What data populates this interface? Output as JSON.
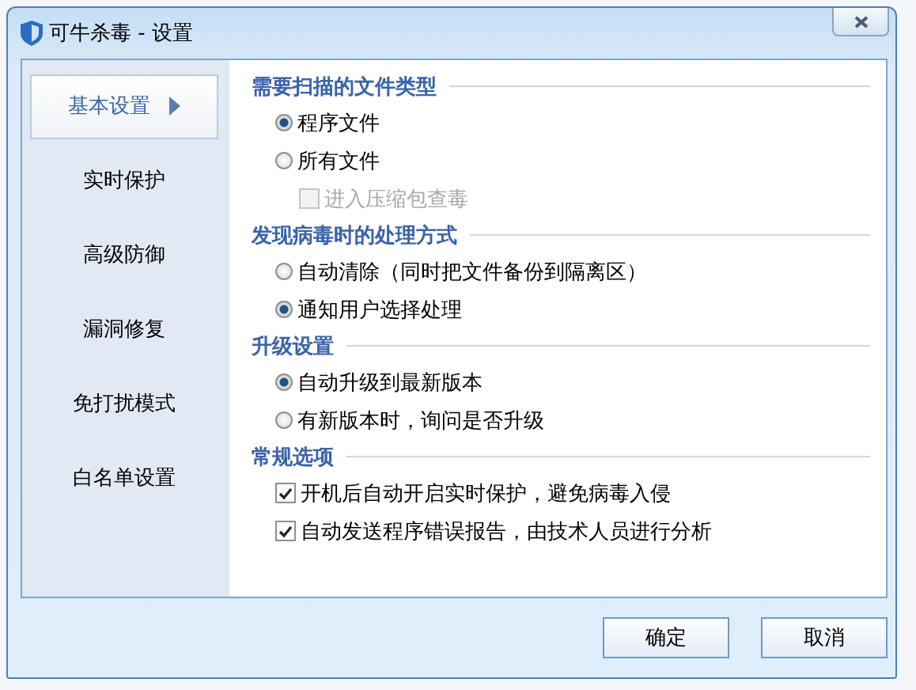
{
  "window": {
    "title": "可牛杀毒 - 设置"
  },
  "sidebar": {
    "items": [
      {
        "label": "基本设置",
        "selected": true
      },
      {
        "label": "实时保护",
        "selected": false
      },
      {
        "label": "高级防御",
        "selected": false
      },
      {
        "label": "漏洞修复",
        "selected": false
      },
      {
        "label": "免打扰模式",
        "selected": false
      },
      {
        "label": "白名单设置",
        "selected": false
      }
    ]
  },
  "sections": [
    {
      "title": "需要扫描的文件类型",
      "options": [
        {
          "kind": "radio",
          "label": "程序文件",
          "selected": true,
          "disabled": false
        },
        {
          "kind": "radio",
          "label": "所有文件",
          "selected": false,
          "disabled": false,
          "children": [
            {
              "kind": "checkbox",
              "label": "进入压缩包查毒",
              "checked": false,
              "disabled": true
            }
          ]
        }
      ]
    },
    {
      "title": "发现病毒时的处理方式",
      "options": [
        {
          "kind": "radio",
          "label": "自动清除（同时把文件备份到隔离区）",
          "selected": false,
          "disabled": false
        },
        {
          "kind": "radio",
          "label": "通知用户选择处理",
          "selected": true,
          "disabled": false
        }
      ]
    },
    {
      "title": "升级设置",
      "options": [
        {
          "kind": "radio",
          "label": "自动升级到最新版本",
          "selected": true,
          "disabled": false
        },
        {
          "kind": "radio",
          "label": "有新版本时，询问是否升级",
          "selected": false,
          "disabled": false
        }
      ]
    },
    {
      "title": "常规选项",
      "options": [
        {
          "kind": "checkbox",
          "label": "开机后自动开启实时保护，避免病毒入侵",
          "checked": true,
          "disabled": false
        },
        {
          "kind": "checkbox",
          "label": "自动发送程序错误报告，由技术人员进行分析",
          "checked": true,
          "disabled": false
        }
      ]
    }
  ],
  "buttons": [
    "确定",
    "取消"
  ]
}
